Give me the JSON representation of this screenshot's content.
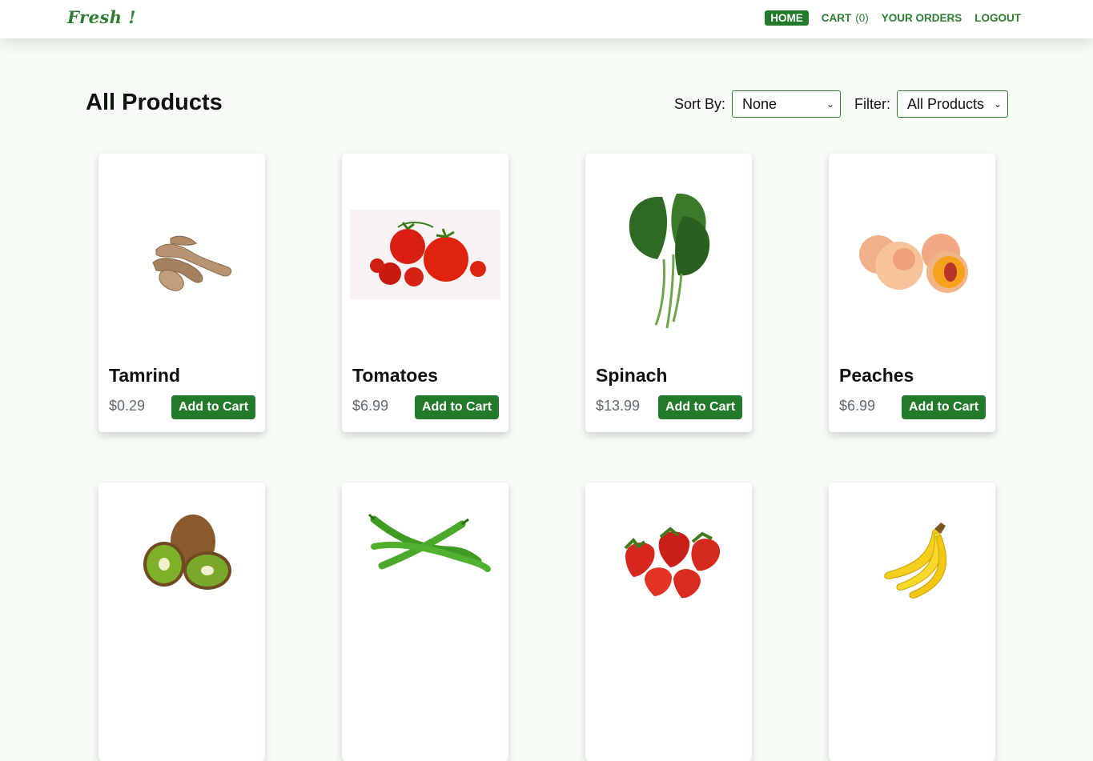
{
  "navbar": {
    "logo": "Fresh !",
    "links": [
      {
        "label": "HOME",
        "active": true
      },
      {
        "label": "CART",
        "count": "(0)"
      },
      {
        "label": "YOUR ORDERS"
      },
      {
        "label": "LOGOUT"
      }
    ]
  },
  "page": {
    "title": "All Products",
    "sort_label": "Sort By:",
    "sort_value": "None",
    "filter_label": "Filter:",
    "filter_value": "All Products"
  },
  "products": [
    {
      "name": "Tamrind",
      "price": "$0.29",
      "button": "Add to Cart",
      "image_icon": "tamarind-icon"
    },
    {
      "name": "Tomatoes",
      "price": "$6.99",
      "button": "Add to Cart",
      "image_icon": "tomatoes-icon"
    },
    {
      "name": "Spinach",
      "price": "$13.99",
      "button": "Add to Cart",
      "image_icon": "spinach-icon"
    },
    {
      "name": "Peaches",
      "price": "$6.99",
      "button": "Add to Cart",
      "image_icon": "peaches-icon"
    },
    {
      "image_icon": "kiwi-icon"
    },
    {
      "image_icon": "green-chili-icon"
    },
    {
      "image_icon": "strawberries-icon"
    },
    {
      "image_icon": "bananas-icon"
    }
  ],
  "colors": {
    "accent": "#237a2a",
    "background": "#f6fdf5"
  }
}
